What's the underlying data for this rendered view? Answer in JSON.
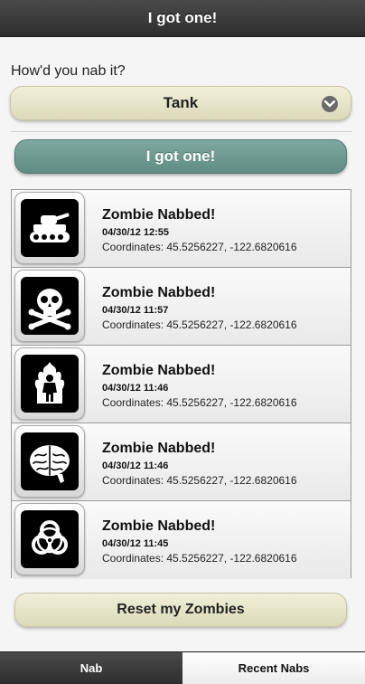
{
  "header": {
    "title": "I got one!"
  },
  "form": {
    "question": "How'd you nab it?",
    "method_selected": "Tank",
    "submit_label": "I got one!"
  },
  "nabs": [
    {
      "icon": "tank-icon",
      "title": "Zombie Nabbed!",
      "date": "04/30/12 12:55",
      "coords": "Coordinates: 45.5256227, -122.6820616"
    },
    {
      "icon": "skull-crossbones-icon",
      "title": "Zombie Nabbed!",
      "date": "04/30/12 11:57",
      "coords": "Coordinates: 45.5256227, -122.6820616"
    },
    {
      "icon": "fire-figure-icon",
      "title": "Zombie Nabbed!",
      "date": "04/30/12 11:46",
      "coords": "Coordinates: 45.5256227, -122.6820616"
    },
    {
      "icon": "brain-icon",
      "title": "Zombie Nabbed!",
      "date": "04/30/12 11:46",
      "coords": "Coordinates: 45.5256227, -122.6820616"
    },
    {
      "icon": "biohazard-icon",
      "title": "Zombie Nabbed!",
      "date": "04/30/12 11:45",
      "coords": "Coordinates: 45.5256227, -122.6820616"
    }
  ],
  "reset_label": "Reset my Zombies",
  "tabs": [
    {
      "label": "Nab",
      "active": true
    },
    {
      "label": "Recent Nabs",
      "active": false
    }
  ],
  "colors": {
    "header_bg": "#3a3a3a",
    "accent_green": "#6f9a91",
    "button_cream": "#e8e6c8"
  }
}
